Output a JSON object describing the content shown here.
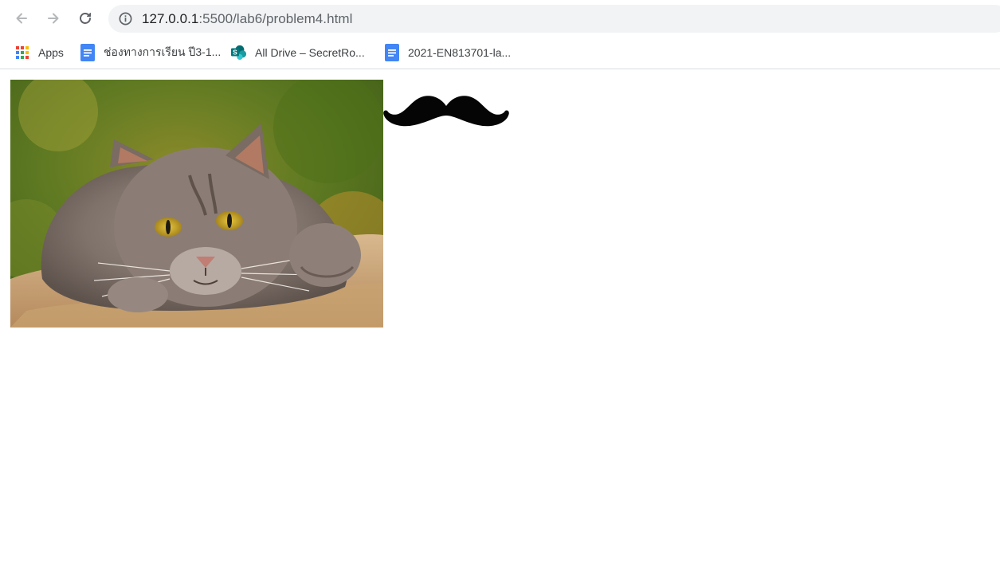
{
  "toolbar": {
    "url_host": "127.0.0.1",
    "url_path": ":5500/lab6/problem4.html"
  },
  "bookmarks": [
    {
      "label": "Apps",
      "icon": "apps-grid-icon"
    },
    {
      "label": "ช่องทางการเรียน ปี3-1...",
      "icon": "google-docs-icon"
    },
    {
      "label": "All Drive – SecretRo...",
      "icon": "sharepoint-icon"
    },
    {
      "label": "2021-EN813701-la...",
      "icon": "google-docs-icon"
    }
  ],
  "page": {
    "images": [
      "cat-photo",
      "mustache-image"
    ]
  },
  "colors": {
    "omnibox_bg": "#f1f3f4",
    "docs_blue": "#4285f4",
    "sharepoint_teal": "#038387"
  }
}
